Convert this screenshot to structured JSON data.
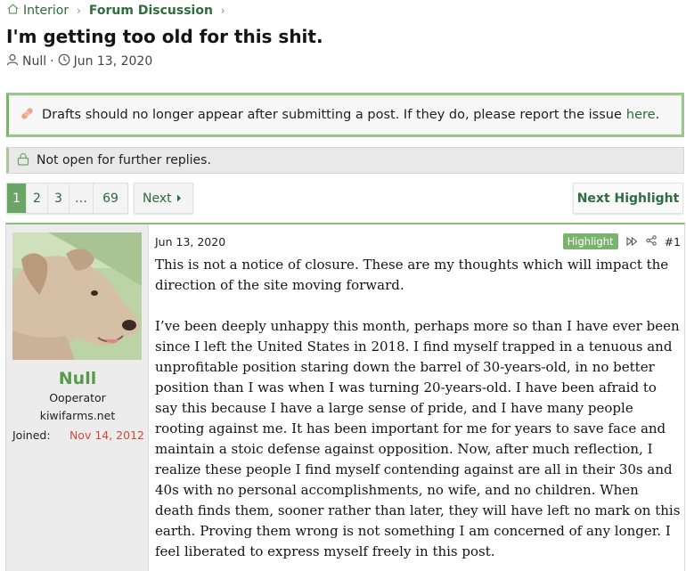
{
  "breadcrumb": {
    "home": "Interior",
    "section": "Forum Discussion"
  },
  "thread": {
    "title": "I'm getting too old for this shit.",
    "author": "Null",
    "date": "Jun 13, 2020"
  },
  "notice": {
    "icon": "bandaid-icon",
    "text": "Drafts should no longer appear after submitting a post. If they do, please report the issue",
    "link": "here",
    "end": "."
  },
  "locked": {
    "text": "Not open for further replies."
  },
  "pagination": {
    "pages": [
      "1",
      "2",
      "3",
      "…",
      "69"
    ],
    "current": "1",
    "next": "Next"
  },
  "next_highlight": "Next Highlight",
  "post": {
    "username": "Null",
    "user_title": "Ooperator",
    "user_banner": "kiwifarms.net",
    "joined_label": "Joined:",
    "joined_value": "Nov 14, 2012",
    "date": "Jun 13, 2020",
    "badge": "Highlight",
    "number": "#1",
    "paragraphs": [
      "This is not a notice of closure. These are my thoughts which will impact the direction of the site moving forward.",
      "I’ve been deeply unhappy this month, perhaps more so than I have ever been since I left the United States in 2018. I find myself trapped in a tenuous and unprofitable position staring down the barrel of 30-years-old, in no better position than I was when I was turning 20-years-old. I have been afraid to say this because I have a large sense of pride, and I have many people rooting against me. It has been important for me for years to save face and maintain a stoic defense against opposition. Now, after much reflection, I realize these people I find myself contending against are all in their 30s and 40s with no personal accomplishments, no wife, and no children. When death finds them, sooner rather than later, they will have left no mark on this earth. Proving them wrong is not something I am concerned of any longer. I feel liberated to express myself freely in this post."
    ]
  },
  "colors": {
    "accent": "#2c6a3a",
    "active_page": "#6aa565",
    "highlight_badge": "#7ab36b",
    "joined_date": "#cf4a3c"
  }
}
